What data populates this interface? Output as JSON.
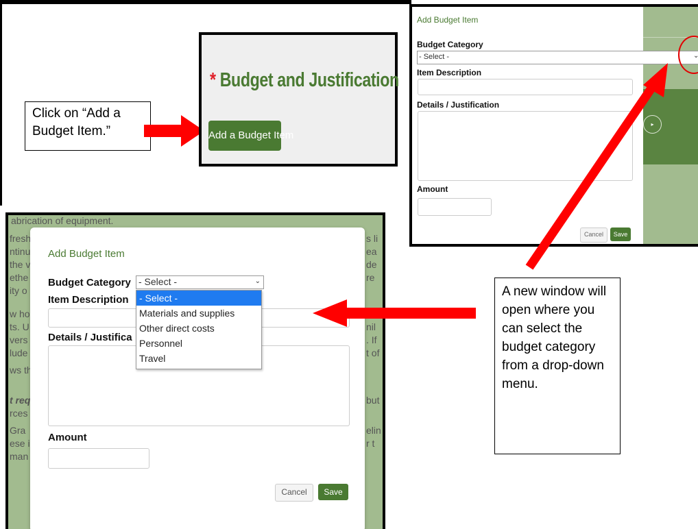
{
  "callouts": {
    "first": "Click on “Add a Budget Item.”",
    "second": "A new window will open where you can select the budget category from a drop-down menu."
  },
  "zoom": {
    "star": "*",
    "title": "Budget and Justification",
    "button": "Add a Budget Item"
  },
  "dialog_small": {
    "title": "Add Budget Item",
    "category_label": "Budget Category",
    "select_value": "- Select -",
    "desc_label": "Item Description",
    "details_label": "Details / Justification",
    "amount_label": "Amount",
    "cancel": "Cancel",
    "save": "Save"
  },
  "dialog_large": {
    "title": "Add Budget Item",
    "category_label": "Budget Category",
    "select_value": "- Select -",
    "desc_label": "Item Description",
    "details_label": "Details / Justifica",
    "amount_label": "Amount",
    "cancel": "Cancel",
    "save": "Save",
    "options": [
      "- Select -",
      "Materials and supplies",
      "Other direct costs",
      "Personnel",
      "Travel"
    ]
  },
  "background_text": {
    "line1": "abrication of equipment.",
    "left": [
      "fresh",
      "ntinu",
      "the v",
      "ethe",
      "ity o",
      "",
      "w ho",
      "ts. U",
      "vers",
      "lude",
      "",
      "ws th",
      "",
      "t req",
      "rces",
      "",
      "Gra",
      "ese i",
      "man"
    ],
    "right": [
      "s li",
      "ea",
      "de",
      "re",
      "",
      "",
      "nil",
      ". If",
      "t of",
      "",
      "",
      "but",
      "",
      "",
      "elin",
      "r t"
    ]
  },
  "colors": {
    "brand_green": "#4a7a32",
    "accent_red": "#e20000",
    "selected_blue": "#1f7bf0"
  }
}
